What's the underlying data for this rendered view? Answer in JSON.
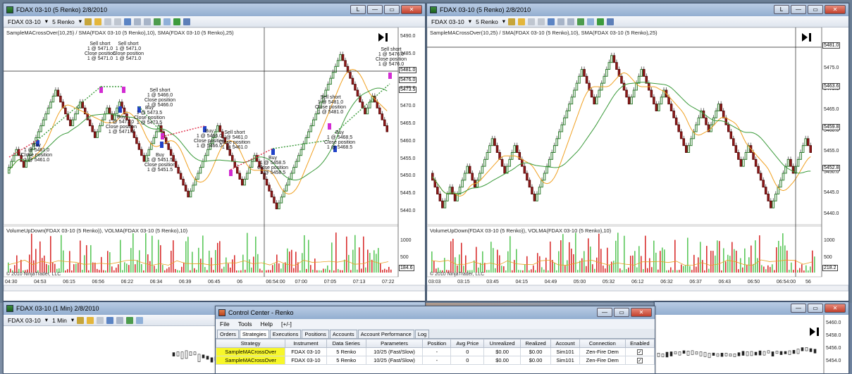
{
  "left_window": {
    "title": "FDAX 03-10 (5 Renko)  2/8/2010",
    "instrument": "FDAX 03-10",
    "period": "5 Renko",
    "title_btn": "L",
    "indicator_header": "SampleMACrossOver(10,25) / SMA(FDAX 03-10 (5 Renko),10), SMA(FDAX 03-10 (5 Renko),25)",
    "volume_header": "VolumeUpDown(FDAX 03-10 (5 Renko)), VOLMA(FDAX 03-10 (5 Renko),10)",
    "copyright": "© 2010 NinjaTrader, LLC",
    "y_labels": [
      "5490.0",
      "5485.0",
      "5480.0",
      "5475.0",
      "5470.0",
      "5465.0",
      "5460.0",
      "5455.0",
      "5450.0",
      "5445.0",
      "5440.0"
    ],
    "price_markers": [
      "5481.0",
      "5476.0",
      "5473.5"
    ],
    "vol_labels": [
      "1000",
      "500"
    ],
    "vol_marker": "184.6",
    "x_labels": [
      "04:30",
      "04:53",
      "06:15",
      "06:56",
      "06:22",
      "06:34",
      "06:39",
      "06:45",
      "06",
      "06:54:00",
      "07:00",
      "07:05",
      "07:13",
      "07:22"
    ],
    "annotations": [
      {
        "text": "Sell short\n1 @ 5471.0\nClose position\n1 @ 5471.0"
      },
      {
        "text": "Sell short\n1 @ 5471.0\nClose position\n1 @ 5471.0"
      },
      {
        "text": "Sell short\n1 @ 5466.0\nClose position\n1 @ 5466.0"
      },
      {
        "text": "Buy\n1 @ 5471.0\nClose position\n1 @ 5471.0"
      },
      {
        "text": "Buy\n1 @ 5473.5\nClose position\n1 @ 5473.5"
      },
      {
        "text": "Buy\n1 @ 5461.0\nClose position\n1 @ 5461.0"
      },
      {
        "text": "Buy\n1 @ 5451.5\nClose position\n1 @ 5451.5"
      },
      {
        "text": "Buy\n1 @ 5466.0\nClose position\n1 @ 5466.0"
      },
      {
        "text": "Sell short\n1 @ 5461.0\nClose position\n1 @ 5461.0"
      },
      {
        "text": "Buy\n1 @ 5458.5\nClose position\n1 @ 5458.5"
      },
      {
        "text": "Sell short\n1 @ 5481.0\nClose position\n1 @ 5481.0"
      },
      {
        "text": "Buy\n1 @ 5468.5\nClose position\n1 @ 5468.5"
      },
      {
        "text": "Sell short\n1 @ 5476.0\nClose position\n1 @ 5476.0"
      }
    ]
  },
  "right_window": {
    "title": "FDAX 03-10 (5 Renko)  2/8/2010",
    "instrument": "FDAX 03-10",
    "period": "5 Renko",
    "title_btn": "L",
    "indicator_header": "SampleMACrossOver(10,25) / SMA(FDAX 03-10 (5 Renko),10), SMA(FDAX 03-10 (5 Renko),25)",
    "volume_header": "VolumeUpDown(FDAX 03-10 (5 Renko)), VOLMA(FDAX 03-10 (5 Renko),10)",
    "copyright": "© 2010 NinjaTrader, LLC",
    "y_labels": [
      "5475.0",
      "5470.0",
      "5465.0",
      "5460.0",
      "5455.0",
      "5450.0",
      "5445.0",
      "5440.0"
    ],
    "price_markers": [
      "5481.0",
      "5463.6",
      "5459.8",
      "5452.8"
    ],
    "vol_labels": [
      "1000",
      "500"
    ],
    "vol_marker": "218.2",
    "x_labels": [
      "03:03",
      "03:15",
      "03:45",
      "04:15",
      "04:49",
      "05:00",
      "05:32",
      "06:12",
      "06:32",
      "06:37",
      "06:43",
      "06:50",
      "06:54:00",
      "56"
    ]
  },
  "bottom_left_window": {
    "title": "FDAX 03-10 (1 Min)  2/8/2010",
    "instrument": "FDAX 03-10",
    "period": "1 Min"
  },
  "bottom_right_window": {
    "y_labels": [
      "5460.0",
      "5458.0",
      "5456.0",
      "5454.0"
    ]
  },
  "control_center": {
    "title": "Control Center - Renko",
    "menu": [
      "File",
      "Tools",
      "Help",
      "[+/-]"
    ],
    "tabs": [
      "Orders",
      "Strategies",
      "Executions",
      "Positions",
      "Accounts",
      "Account Performance",
      "Log"
    ],
    "active_tab": "Strategies",
    "columns": [
      "Strategy",
      "Instrument",
      "Data Series",
      "Parameters",
      "Position",
      "Avg Price",
      "Unrealized",
      "Realized",
      "Account",
      "Connection",
      "Enabled"
    ],
    "rows": [
      [
        "SampleMACrossOver",
        "FDAX 03-10",
        "5 Renko",
        "10/25 (Fast/Slow)",
        "-",
        "0",
        "$0.00",
        "$0.00",
        "Sim101",
        "Zen-Fire Dem",
        "✓"
      ],
      [
        "SampleMACrossOver",
        "FDAX 03-10",
        "5 Renko",
        "10/25 (Fast/Slow)",
        "-",
        "0",
        "$0.00",
        "$0.00",
        "Sim101",
        "Zen-Fire Dem",
        "✓"
      ]
    ]
  },
  "colors": {
    "up_bar": "#2f7d2f",
    "down_bar": "#9b1c1c",
    "sma_fast": "#f0a020",
    "sma_slow": "#3a9a3a",
    "vol_up": "#5cc85c",
    "vol_down": "#d93030"
  }
}
